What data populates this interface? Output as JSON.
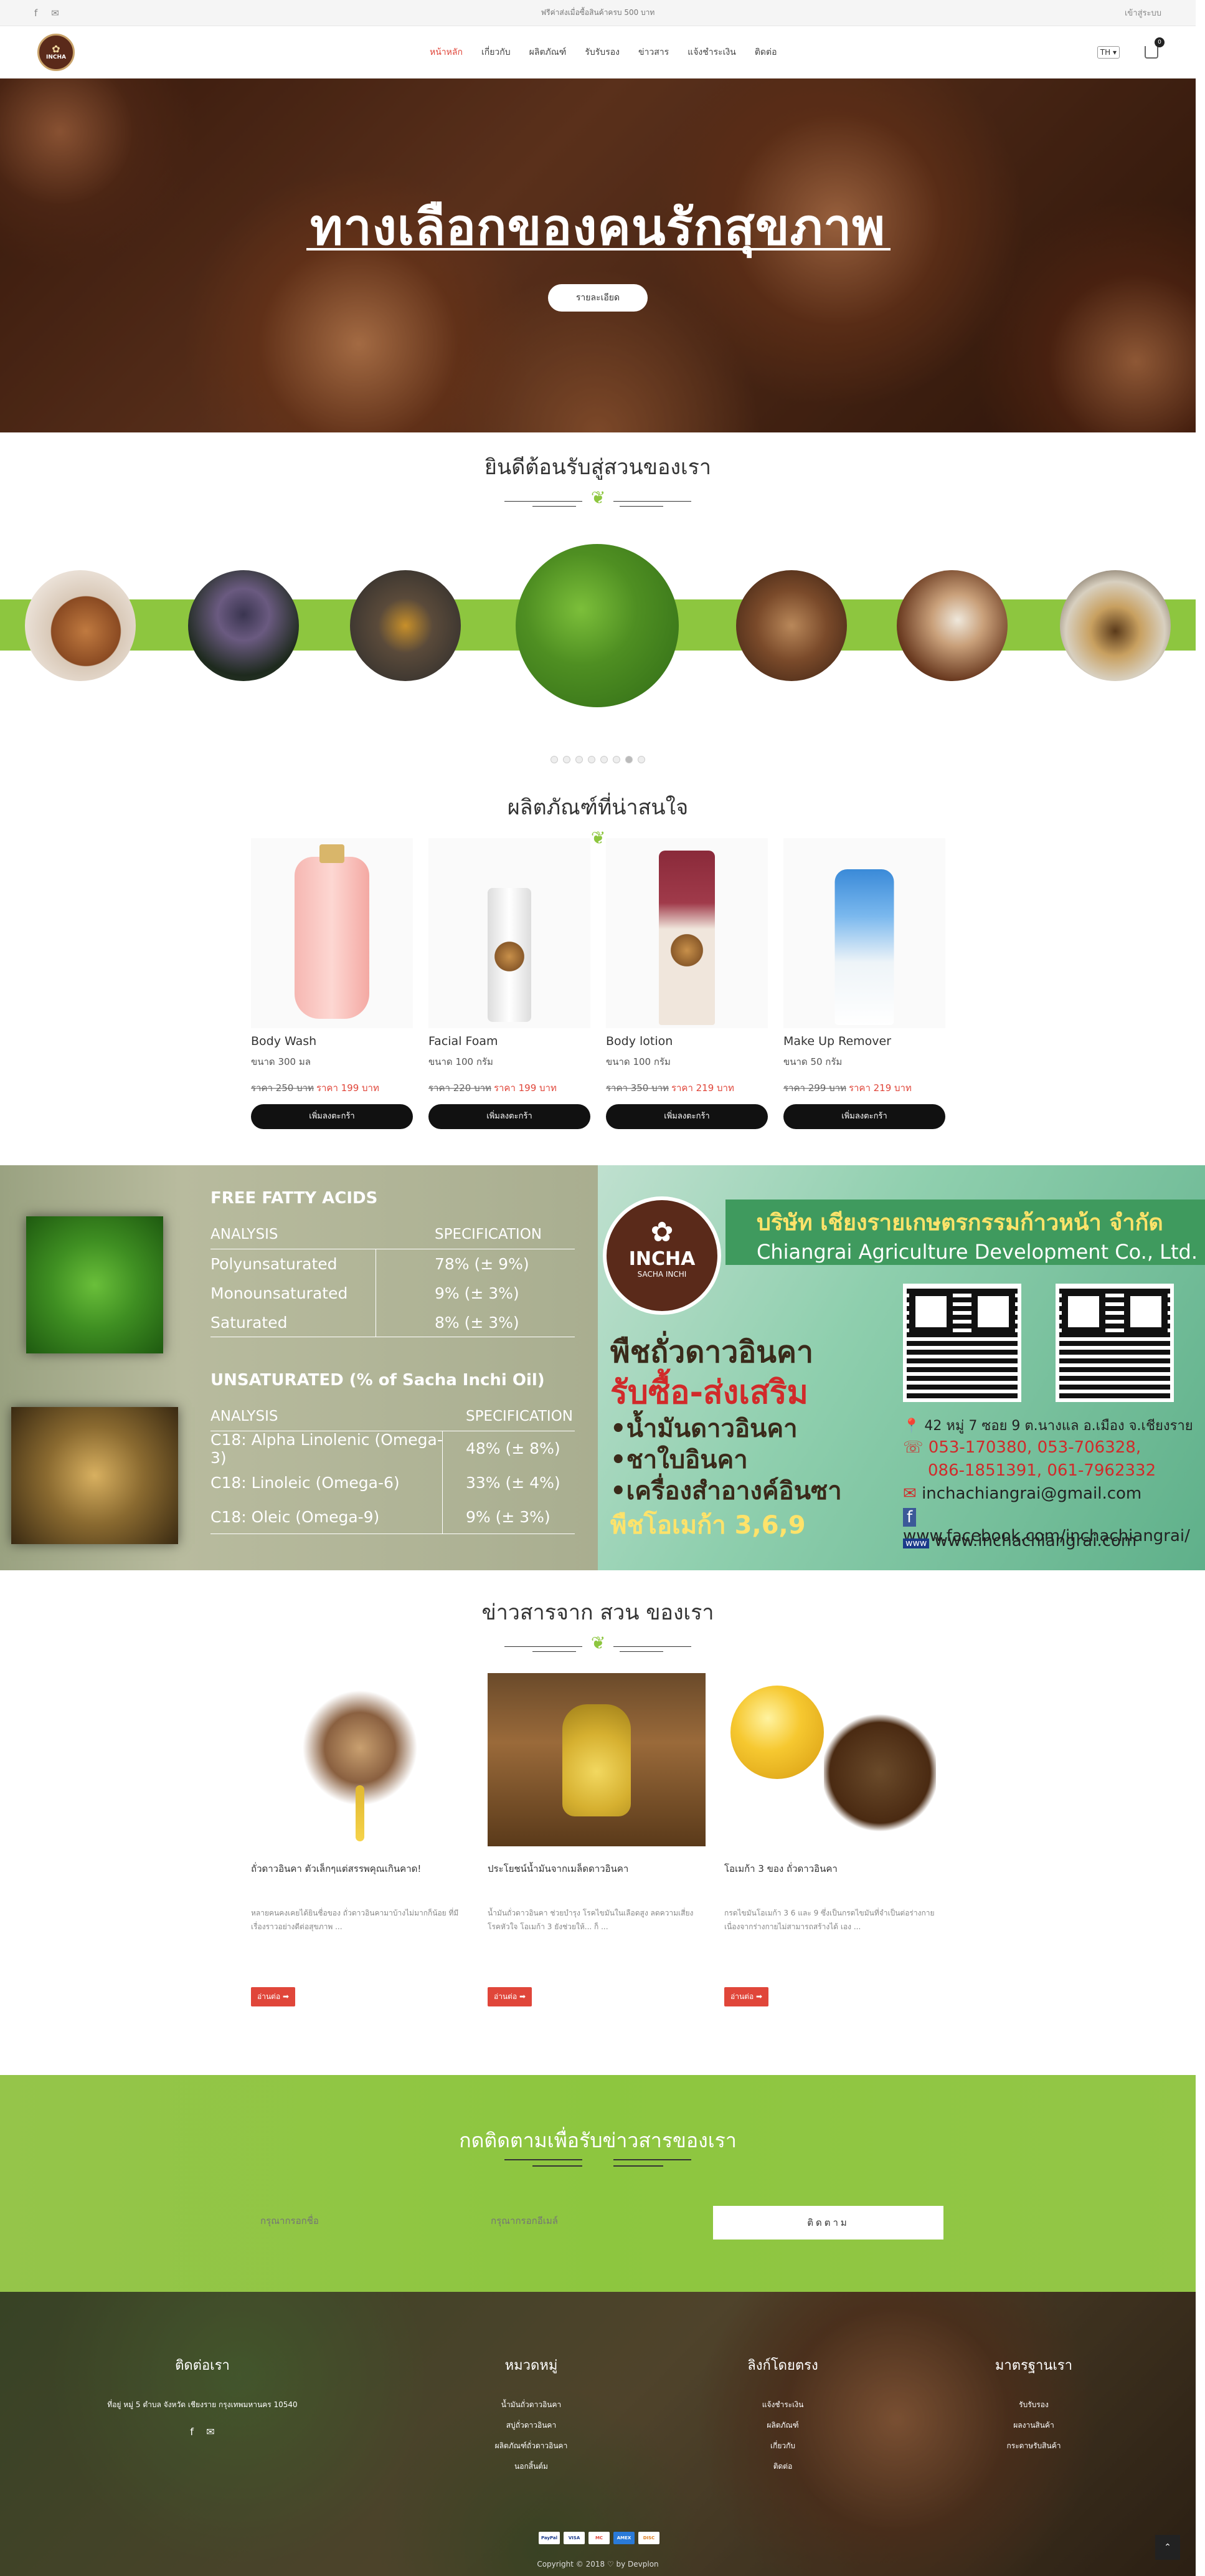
{
  "topbar": {
    "promo": "ฟรีค่าส่งเมื่อซื้อสินค้าครบ 500 บาท",
    "login": "เข้าสู่ระบบ"
  },
  "nav": {
    "logo_text": "INCHA",
    "items": [
      "หน้าหลัก",
      "เกี่ยวกับ",
      "ผลิตภัณฑ์",
      "รับรับรอง",
      "ข่าวสาร",
      "แจ้งชำระเงิน",
      "ติดต่อ"
    ],
    "lang": "TH",
    "cart_count": "0"
  },
  "hero": {
    "title": "ทางเลือกของคนรักสุขภาพ",
    "button": "รายละเอียด"
  },
  "welcome": {
    "title": "ยินดีต้อนรับสู่สวนของเรา"
  },
  "products": {
    "title": "ผลิตภัณฑ์ที่น่าสนใจ",
    "add_label": "เพิ่มลงตะกร้า",
    "items": [
      {
        "name": "Body Wash",
        "size": "ขนาด 300 มล",
        "old": "ราคา 250 บาท",
        "new": "ราคา 199 บาท"
      },
      {
        "name": "Facial Foam",
        "size": "ขนาด 100 กรัม",
        "old": "ราคา 220 บาท",
        "new": "ราคา 199 บาท"
      },
      {
        "name": "Body lotion",
        "size": "ขนาด 100 กรัม",
        "old": "ราคา 350 บาท",
        "new": "ราคา 219 บาท"
      },
      {
        "name": "Make Up Remover",
        "size": "ขนาด 50 กรัม",
        "old": "ราคา 299 บาท",
        "new": "ราคา 219 บาท"
      }
    ]
  },
  "fatty": {
    "title1": "FREE FATTY ACIDS",
    "head_a": "ANALYSIS",
    "head_b": "SPECIFICATION",
    "rows1": [
      {
        "a": "Polyunsaturated",
        "b": "78% (± 9%)"
      },
      {
        "a": "Monounsaturated",
        "b": "9% (± 3%)"
      },
      {
        "a": "Saturated",
        "b": "8% (± 3%)"
      }
    ],
    "title2": "UNSATURATED (% of Sacha Inchi Oil)",
    "rows2": [
      {
        "a": "C18: Alpha Linolenic (Omega-3)",
        "b": "48% (± 8%)"
      },
      {
        "a": "C18: Linoleic (Omega-6)",
        "b": "33% (± 4%)"
      },
      {
        "a": "C18: Oleic (Omega-9)",
        "b": "9% (± 3%)"
      }
    ]
  },
  "ad": {
    "logo1": "INCHA",
    "logo2": "SACHA INCHI",
    "company_th": "บริษัท เชียงรายเกษตรกรรมก้าวหน้า จำกัด",
    "company_en": "Chiangrai Agriculture Development Co., Ltd.",
    "line1": "พืชถั่วดาวอินคา",
    "line2": "รับซื้อ-ส่งเสริม",
    "line3": "•น้ำมันดาวอินคา",
    "line4": "•ชาใบอินคา",
    "line5": "•เครื่องสำอางค์อินซา",
    "line6": "พืชโอเมก้า 3,6,9",
    "address": "42 หมู่ 7 ซอย 9 ต.นางแล อ.เมือง จ.เชียงราย",
    "phone1": "053-170380, 053-706328,",
    "phone2": "086-1851391, 061-7962332",
    "email": "inchachiangrai@gmail.com",
    "facebook": "www.facebook.com/inchachiangrai/",
    "web": "www.inchachiangrai.com"
  },
  "news": {
    "title": "ข่าวสารจาก สวน ของเรา",
    "more": "อ่านต่อ",
    "items": [
      {
        "title": "ถั่วดาวอินคา ตัวเล็กๆแต่สรรพคุณเกินคาด!",
        "desc": "หลายคนคงเคยได้ยินชื่อของ ถั่วดาวอินคามาบ้างไม่มากก็น้อย ที่มีเรื่องราวอย่างดีต่อสุขภาพ ..."
      },
      {
        "title": "ประโยชน์น้ำมันจากเมล็ดดาวอินคา",
        "desc": "น้ำมันถั่วดาวอินคา ช่วยบำรุง โรคไขมันในเลือดสูง ลดความเสี่ยงโรคหัวใจ โอเมก้า 3 ยังช่วยให้... ก็ ..."
      },
      {
        "title": "โอเมก้า 3 ของ ถั่วดาวอินคา",
        "desc": "กรดไขมันโอเมก้า 3 6 และ 9 ซึ่งเป็นกรดไขมันที่จำเป็นต่อร่างกาย เนื่องจากร่างกายไม่สามารถสร้างได้ เอง ..."
      }
    ]
  },
  "newsletter": {
    "title": "กดติดตามเพื่อรับข่าวสารของเรา",
    "name_placeholder": "กรุณากรอกชื่อ",
    "email_placeholder": "กรุณากรอกอีเมล์",
    "button": "ติดตาม"
  },
  "footer": {
    "contact_title": "ติดต่อเรา",
    "contact_addr": "ที่อยู่ หมู่ 5 ตำบล จังหวัด เชียงราย กรุงเทพมหานคร 10540",
    "cat_title": "หมวดหมู่",
    "cats": [
      "น้ำมันถั่วดาวอินคา",
      "สบู่ถั่วดาวอินคา",
      "ผลิตภัณฑ์ถั่วดาวอินคา",
      "นอกสิ้นต์ม"
    ],
    "links_title": "ลิงก์โดยตรง",
    "links": [
      "แจ้งชำระเงิน",
      "ผลิตภัณฑ์",
      "เกี่ยวกับ",
      "ติดต่อ"
    ],
    "std_title": "มาตรฐานเรา",
    "stds": [
      "รับรับรอง",
      "ผลงานสินค้า",
      "กระดาษรับสินค้า"
    ],
    "pay": [
      "PayPal",
      "VISA",
      "MC",
      "AMEX",
      "DISC"
    ],
    "copyright": "Copyright © 2018 ♡ by Devplon"
  }
}
